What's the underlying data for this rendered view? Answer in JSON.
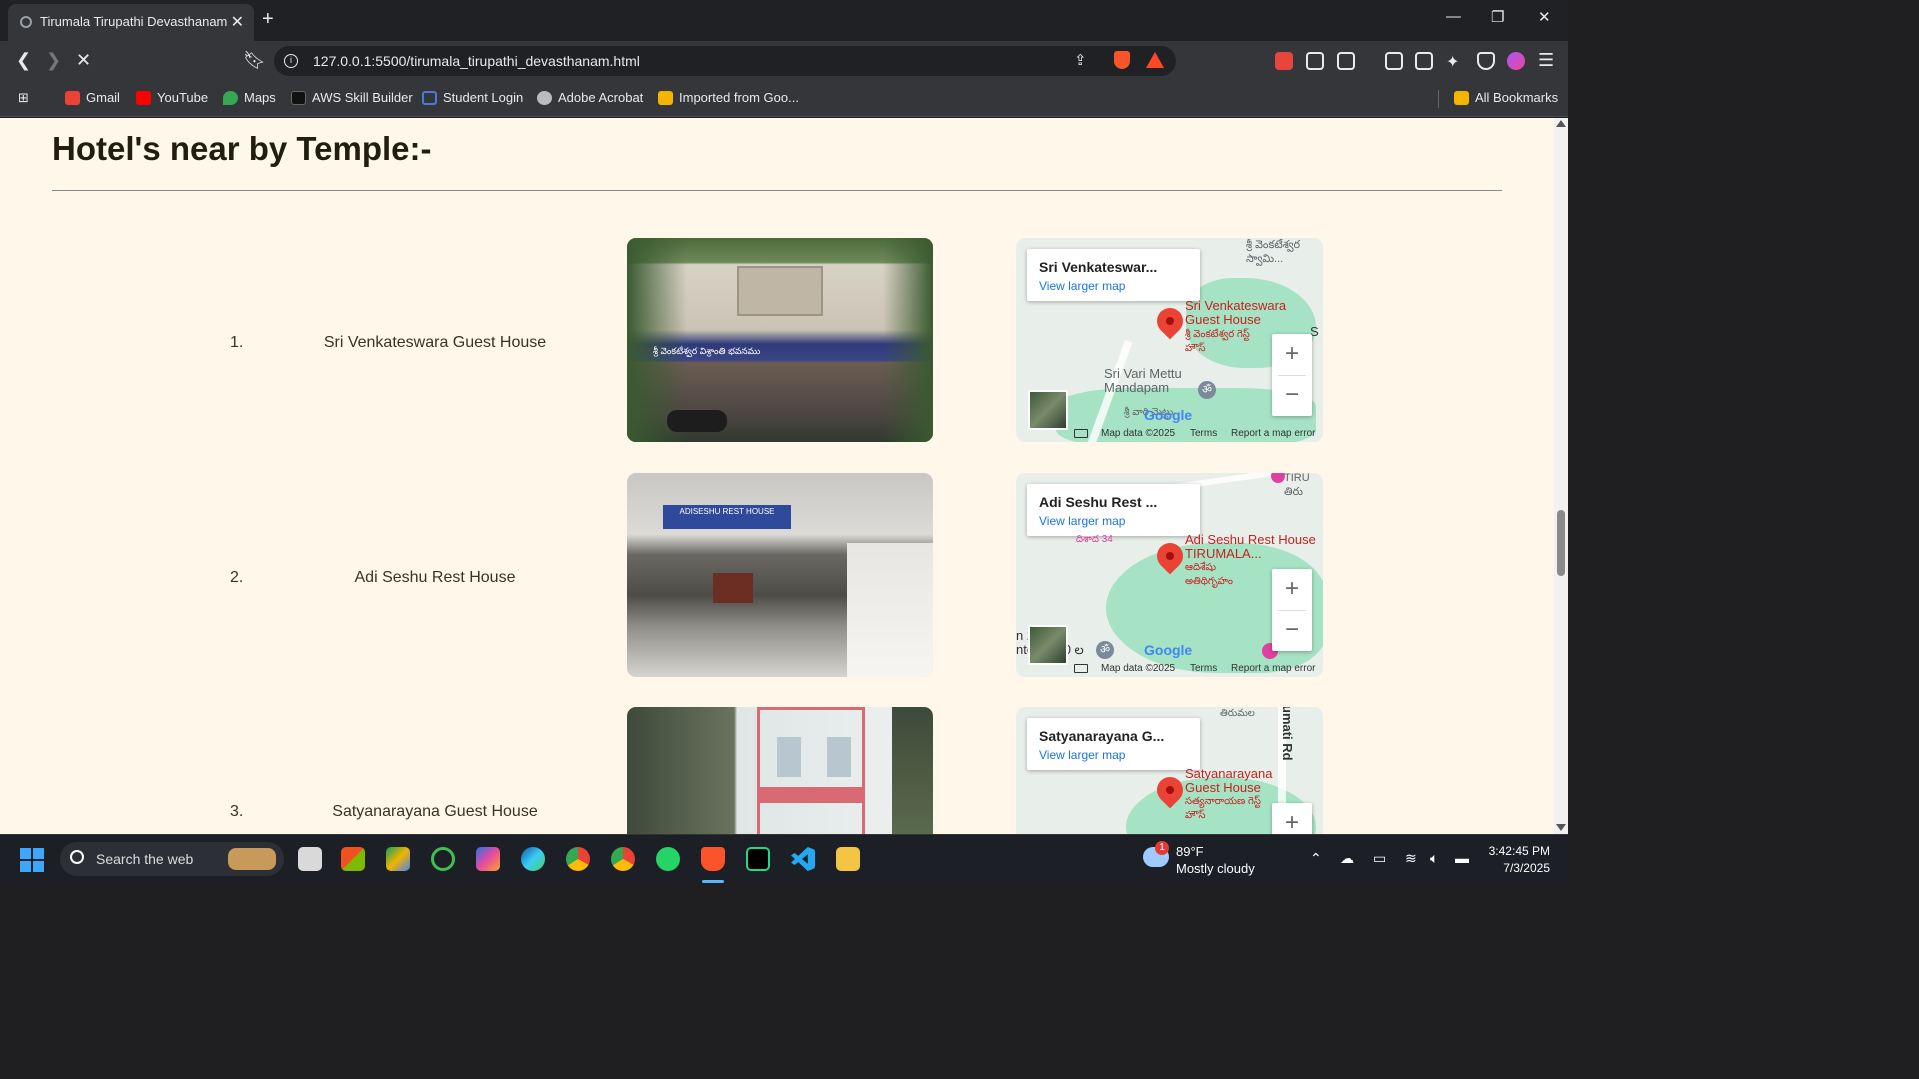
{
  "browser": {
    "tab_title": "Tirumala Tirupathi Devasthanam",
    "url": "127.0.0.1:5500/tirumala_tirupathi_devasthanam.html",
    "bookmarks": [
      "Gmail",
      "YouTube",
      "Maps",
      "AWS Skill Builder",
      "Student Login",
      "Adobe Acrobat",
      "Imported from Goo..."
    ],
    "all_bookmarks": "All Bookmarks"
  },
  "page": {
    "heading": "Hotel's near by Temple:-",
    "hotels": [
      {
        "number": "1.",
        "name": "Sri Venkateswara Guest House",
        "map_title": "Sri Venkateswar...",
        "map_link": "View larger map",
        "pin_label": "Sri Venkateswara Guest House",
        "pin_label_te": "శ్రీ వెంకటేశ్వర గెస్ట్ హౌస్",
        "place": "Sri Vari Mettu Mandapam",
        "place_te": "శ్రీ వారి మెట్టు"
      },
      {
        "number": "2.",
        "name": "Adi Seshu Rest House",
        "map_title": "Adi Seshu Rest ...",
        "map_link": "View larger map",
        "pin_label": "Adi Seshu Rest House TIRUMALA...",
        "pin_label_te": "ఆదిశేషు అతిథిగృహం"
      },
      {
        "number": "3.",
        "name": "Satyanarayana Guest House",
        "map_title": "Satyanarayana G...",
        "map_link": "View larger map",
        "pin_label": "Satyanarayana Guest House",
        "pin_label_te": "సత్యనారాయణ గెస్ట్ హౌస్",
        "road": "umati Rd"
      }
    ],
    "photo_sign_1": "శ్రీ వెంకటేశ్వర విశ్రాంతి భవనము",
    "photo_sign_2": "ADISESHU REST HOUSE",
    "map_attribution": {
      "data": "Map data ©2025",
      "terms": "Terms",
      "report": "Report a map error",
      "google": "Google"
    }
  },
  "taskbar": {
    "search_placeholder": "Search the web",
    "weather_temp": "89°F",
    "weather_desc": "Mostly cloudy",
    "weather_badge": "1",
    "time": "3:42:45 PM",
    "date": "7/3/2025"
  },
  "colors": {
    "page_bg": "#fff8ea",
    "heading": "#231d10",
    "map_water": "#a6e3c5",
    "pin": "#ea4335",
    "link": "#1a73e8"
  }
}
